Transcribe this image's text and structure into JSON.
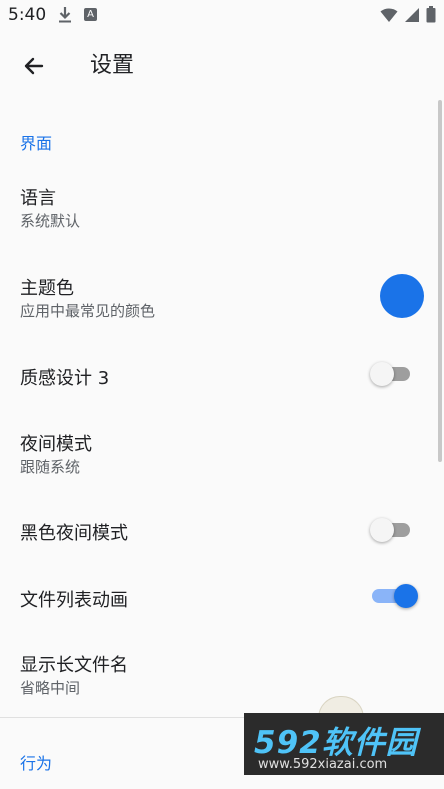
{
  "status_bar": {
    "time": "5:40",
    "a_badge": "A"
  },
  "app_bar": {
    "title": "设置"
  },
  "sections": {
    "interface": "界面",
    "behavior": "行为"
  },
  "items": {
    "language": {
      "label": "语言",
      "summary": "系统默认"
    },
    "theme_color": {
      "label": "主题色",
      "summary": "应用中最常见的颜色",
      "color": "#1a73e8"
    },
    "material3": {
      "label": "质感设计 3",
      "enabled": false
    },
    "night_mode": {
      "label": "夜间模式",
      "summary": "跟随系统"
    },
    "black_night": {
      "label": "黑色夜间模式",
      "enabled": false
    },
    "list_anim": {
      "label": "文件列表动画",
      "enabled": true
    },
    "long_name": {
      "label": "显示长文件名",
      "summary": "省略中间"
    }
  },
  "watermark": {
    "brand": "592软件园",
    "url": "www.592xiazai.com"
  }
}
